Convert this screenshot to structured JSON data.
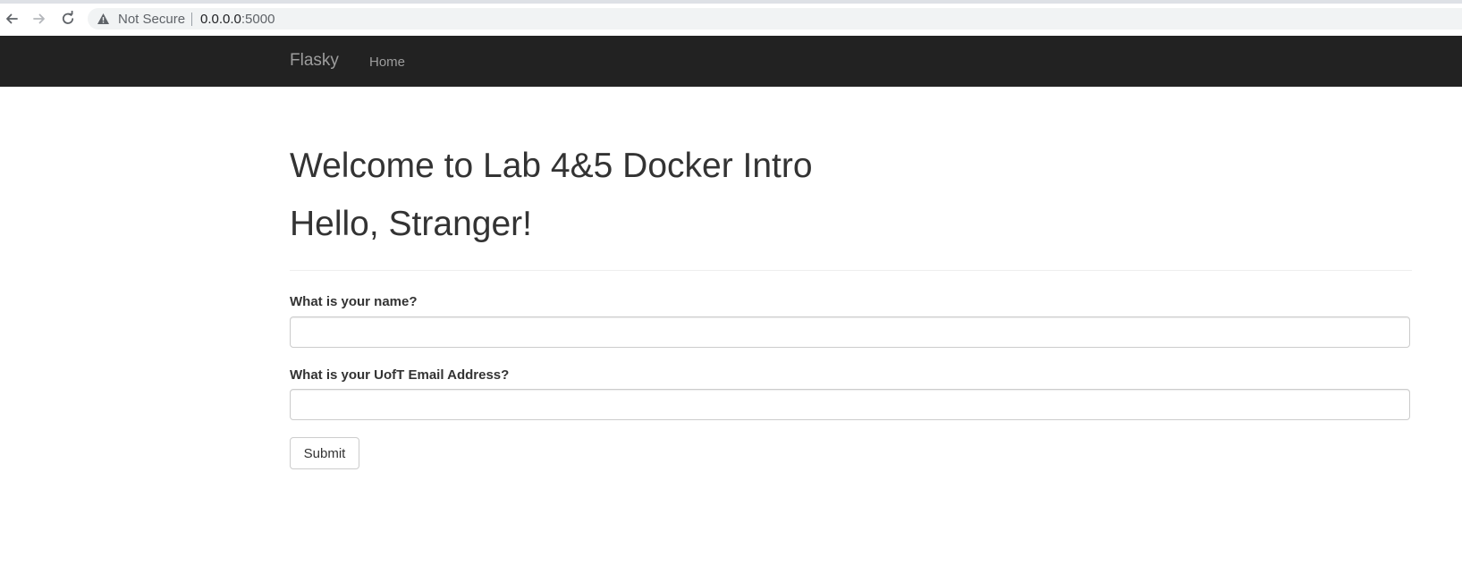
{
  "browser": {
    "security_label": "Not Secure",
    "url_host": "0.0.0.0",
    "url_port": ":5000"
  },
  "navbar": {
    "brand": "Flasky",
    "links": [
      "Home"
    ]
  },
  "page": {
    "title": "Welcome to Lab 4&5 Docker Intro",
    "greeting": "Hello, Stranger!"
  },
  "form": {
    "name_label": "What is your name?",
    "name_value": "",
    "email_label": "What is your UofT Email Address?",
    "email_value": "",
    "submit_label": "Submit"
  },
  "colors": {
    "navbar_bg": "#222222",
    "navbar_text": "#9d9d9d",
    "heading_text": "#333333"
  }
}
